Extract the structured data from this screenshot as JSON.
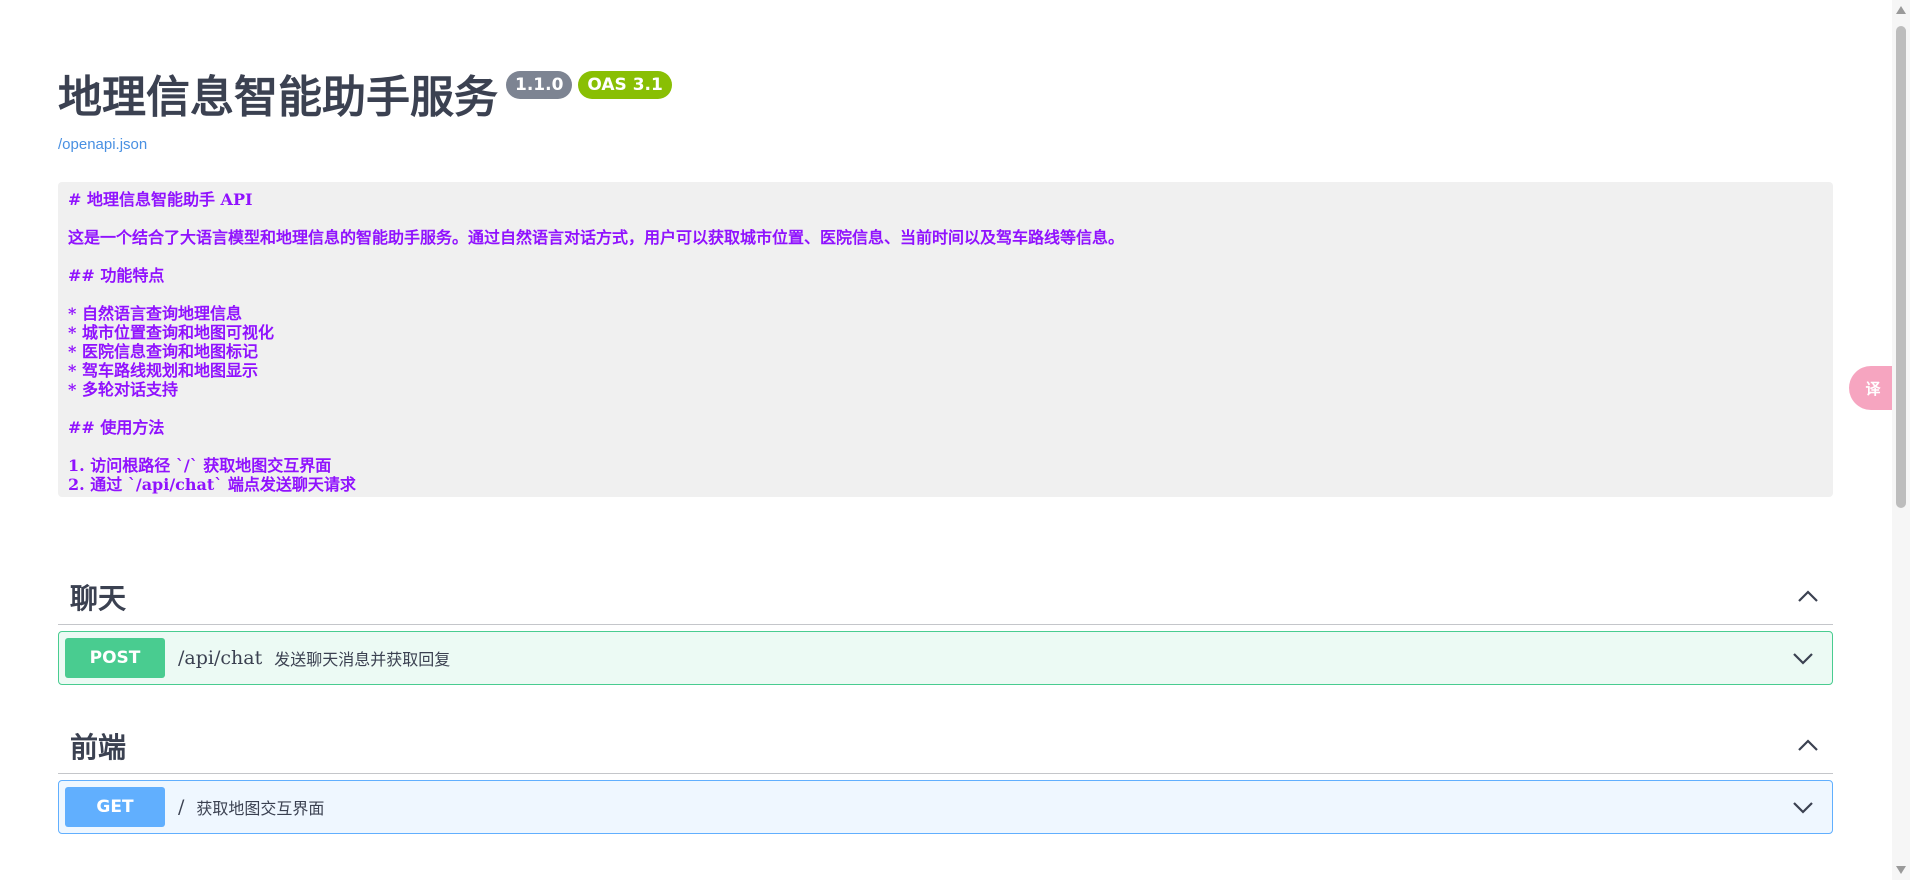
{
  "info": {
    "title": "地理信息智能助手服务",
    "version": "1.1.0",
    "oas": "OAS 3.1",
    "spec_link": "/openapi.json"
  },
  "description_lines": [
    "# 地理信息智能助手 API",
    "",
    "这是一个结合了大语言模型和地理信息的智能助手服务。通过自然语言对话方式，用户可以获取城市位置、医院信息、当前时间以及驾车路线等信息。",
    "",
    "## 功能特点",
    "",
    "* 自然语言查询地理信息",
    "* 城市位置查询和地图可视化",
    "* 医院信息查询和地图标记",
    "* 驾车路线规划和地图显示",
    "* 多轮对话支持",
    "",
    "## 使用方法",
    "",
    "1. 访问根路径 `/` 获取地图交互界面",
    "2. 通过 `/api/chat` 端点发送聊天请求"
  ],
  "tags": [
    {
      "name": "聊天",
      "operation": {
        "method": "POST",
        "path": "/api/chat",
        "summary": "发送聊天消息并获取回复"
      }
    },
    {
      "name": "前端",
      "operation": {
        "method": "GET",
        "path": "/",
        "summary": "获取地图交互界面"
      }
    }
  ],
  "translate_fab": {
    "label": "译",
    "icon": "translate-icon"
  },
  "colors": {
    "post": "#49cc90",
    "get": "#61affe",
    "description_text": "#9012fe",
    "version_badge": "#7d8492",
    "oas_badge": "#89bf04",
    "link": "#4990e2"
  }
}
